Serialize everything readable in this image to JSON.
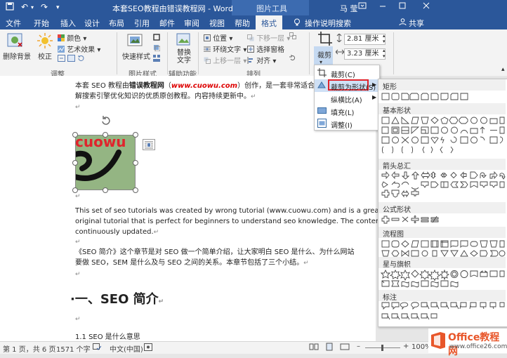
{
  "title_bar": {
    "doc_title": "本套SEO教程由错误教程网 - Word",
    "context_title": "图片工具",
    "user": "马 莹",
    "undo_arrow": "↶",
    "redo_arrow": "↷"
  },
  "tabs": [
    "文件",
    "开始",
    "插入",
    "设计",
    "布局",
    "引用",
    "邮件",
    "审阅",
    "视图",
    "帮助",
    "格式"
  ],
  "tell_me": "操作说明搜索",
  "share": "共享",
  "ribbon": {
    "remove_bg": "删除背景",
    "correct": "校正",
    "color": "颜色",
    "artistic": "艺术效果",
    "adjust_group": "调整",
    "quick_styles": "快速样式",
    "pic_styles_group": "图片样式",
    "alt_text": "替换\n文字",
    "alt_text_l1": "替换",
    "alt_text_l2": "文字",
    "accessibility_group": "辅助功能",
    "position": "位置",
    "wrap_text": "环绕文字",
    "bring_forward": "上移一层",
    "send_backward": "下移一层",
    "selection_pane": "选择窗格",
    "align": "对齐",
    "arrange_group": "排列",
    "crop": "裁剪",
    "height": "2.81 厘米",
    "width": "3.23 厘米"
  },
  "crop_menu": {
    "items": [
      "裁剪(C)",
      "裁剪为形状(S)",
      "纵横比(A)",
      "填充(L)",
      "调整(I)"
    ]
  },
  "shape_menu": {
    "categories": [
      "矩形",
      "基本形状",
      "箭头总汇",
      "公式形状",
      "流程图",
      "星与旗帜",
      "标注"
    ]
  },
  "document": {
    "para1_a": "本套 SEO 教程由",
    "para1_b": "错误教程网",
    "para1_c": "（",
    "para1_url": "www.cuowu.com",
    "para1_d": "）创作，是一套非常适合初学",
    "para1_line2": "解搜索引擎优化知识的优质原创教程。内容持续更新中。",
    "image_text": "cuowu",
    "eng1": "This set of seo tutorials was created by wrong tutorial (www.cuowu.com) and is a great",
    "eng2": "original tutorial that is perfect for beginners to understand seo knowledge. The content is",
    "eng3": "continuously updated.",
    "cn1": "《SEO 简介》这个章节是对 SEO 做一个简单介绍，让大家明白 SEO 是什么、为什么网站",
    "cn2": "要做 SEO，SEM 是什么及与 SEO 之间的关系。本章节包括了三个小结。",
    "heading": "·一、SEO 简介",
    "sub": "1.1 SEO 是什么意思"
  },
  "status": {
    "page": "第 1 页，共 6 页",
    "words": "1571 个字",
    "lang": "中文(中国)",
    "zoom": "100%"
  },
  "watermark": {
    "brand": "Office教程网",
    "url": "www.office26.com"
  },
  "colors": {
    "word_blue": "#2b579a",
    "highlight": "#cfe0f5",
    "red_outline": "#e0242c",
    "image_green": "#94b583"
  }
}
